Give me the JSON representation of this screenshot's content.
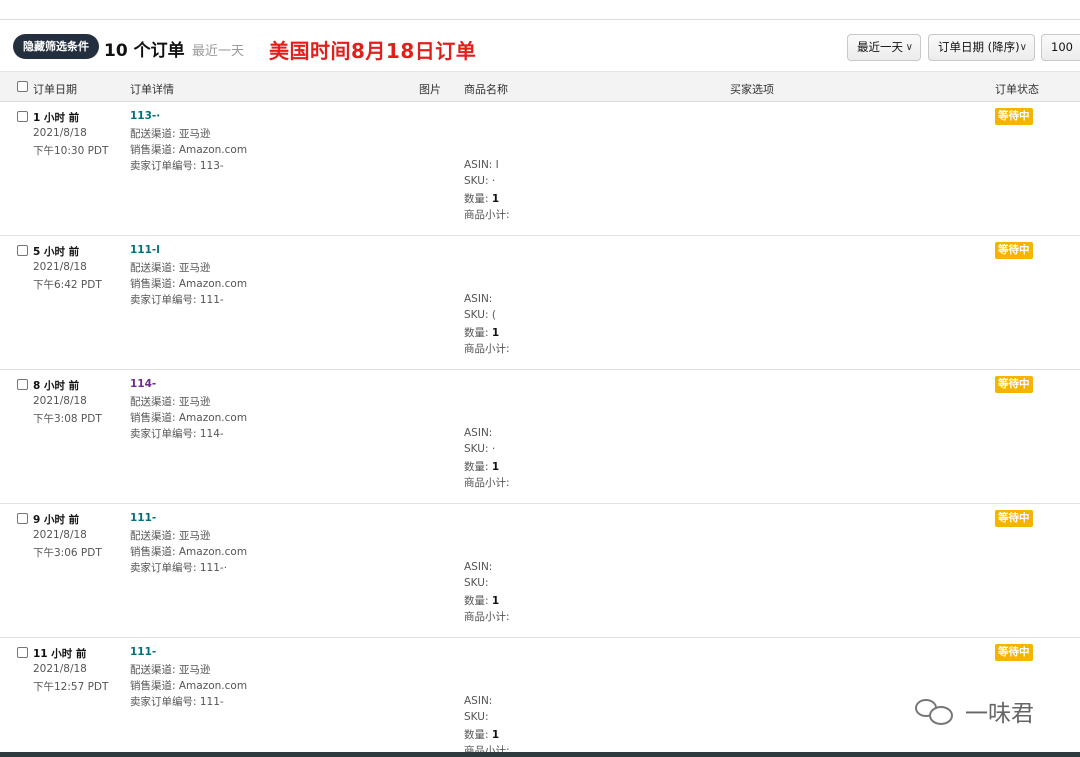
{
  "toolbar": {
    "hide_filter_label": "隐藏筛选条件",
    "order_count": "10 个订单",
    "range_caption": "最近一天",
    "headline": "美国时间8月18日订单",
    "range_select": "最近一天",
    "sort_select": "订单日期 (降序)",
    "page_size_select": "100"
  },
  "table": {
    "columns": {
      "order_date": "订单日期",
      "order_details": "订单详情",
      "image": "图片",
      "product_name": "商品名称",
      "buyer_options": "买家选项",
      "order_status": "订单状态"
    },
    "rows": [
      {
        "relative_time": "1 小时 前",
        "date": "2021/8/18",
        "time": "下午10:30 PDT",
        "order_id": "113-·",
        "shipping": "配送渠道: 亚马逊",
        "channel": "销售渠道: Amazon.com",
        "seller_order": "卖家订单编号: 113-",
        "asin": "ASIN: I",
        "sku": "SKU: ·",
        "qty_label": "数量:",
        "qty_value": "1",
        "subtotal": "商品小计:",
        "status": "等待中"
      },
      {
        "relative_time": "5 小时 前",
        "date": "2021/8/18",
        "time": "下午6:42 PDT",
        "order_id": "111-l",
        "shipping": "配送渠道: 亚马逊",
        "channel": "销售渠道: Amazon.com",
        "seller_order": "卖家订单编号: 111-",
        "asin": "ASIN:",
        "sku": "SKU: (",
        "qty_label": "数量:",
        "qty_value": "1",
        "subtotal": "商品小计:",
        "status": "等待中"
      },
      {
        "relative_time": "8 小时 前",
        "date": "2021/8/18",
        "time": "下午3:08 PDT",
        "order_id": "114-",
        "shipping": "配送渠道: 亚马逊",
        "channel": "销售渠道: Amazon.com",
        "seller_order": "卖家订单编号: 114-",
        "asin": "ASIN:",
        "sku": "SKU: ·",
        "qty_label": "数量:",
        "qty_value": "1",
        "subtotal": "商品小计:",
        "status": "等待中"
      },
      {
        "relative_time": "9 小时 前",
        "date": "2021/8/18",
        "time": "下午3:06 PDT",
        "order_id": "111-",
        "shipping": "配送渠道: 亚马逊",
        "channel": "销售渠道: Amazon.com",
        "seller_order": "卖家订单编号: 111-·",
        "asin": "ASIN:",
        "sku": "SKU:",
        "qty_label": "数量:",
        "qty_value": "1",
        "subtotal": "商品小计:",
        "status": "等待中"
      },
      {
        "relative_time": "11 小时 前",
        "date": "2021/8/18",
        "time": "下午12:57 PDT",
        "order_id": "111-",
        "shipping": "配送渠道: 亚马逊",
        "channel": "销售渠道: Amazon.com",
        "seller_order": "卖家订单编号: 111-",
        "asin": "ASIN:",
        "sku": "SKU:",
        "qty_label": "数量:",
        "qty_value": "1",
        "subtotal": "商品小计:",
        "status": "等待中"
      }
    ]
  },
  "watermark": {
    "icon": "wechat-icon",
    "text": "一味君"
  },
  "colors": {
    "headline": "#e0201d",
    "status_badge": "#f5b400",
    "order_link": "#00707a",
    "order_link_visited": "#6f2a91",
    "filter_button": "#232f3e"
  }
}
